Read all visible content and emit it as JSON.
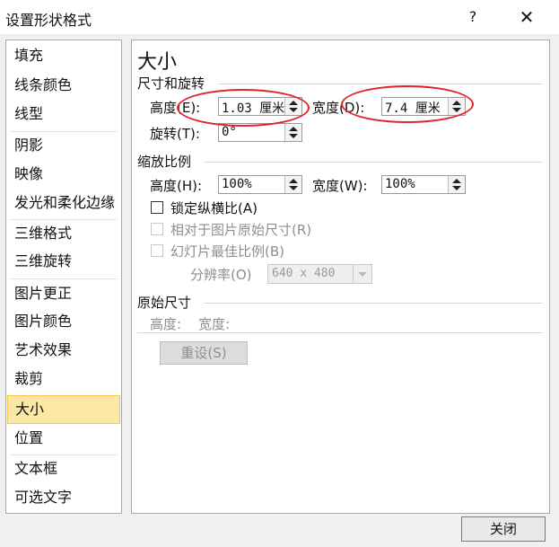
{
  "window": {
    "title": "设置形状格式",
    "help_label": "?",
    "close_label": "✕"
  },
  "sidebar": {
    "items": [
      {
        "label": "填充"
      },
      {
        "label": "线条颜色"
      },
      {
        "label": "线型"
      },
      {
        "label": "阴影"
      },
      {
        "label": "映像"
      },
      {
        "label": "发光和柔化边缘"
      },
      {
        "label": "三维格式"
      },
      {
        "label": "三维旋转"
      },
      {
        "label": "图片更正"
      },
      {
        "label": "图片颜色"
      },
      {
        "label": "艺术效果"
      },
      {
        "label": "裁剪"
      },
      {
        "label": "大小",
        "selected": true
      },
      {
        "label": "位置"
      },
      {
        "label": "文本框"
      },
      {
        "label": "可选文字"
      }
    ]
  },
  "panel": {
    "heading": "大小",
    "size_section": {
      "title": "尺寸和旋转",
      "height_label": "高度(E):",
      "height_value": "1.03 厘米",
      "width_label": "宽度(D):",
      "width_value": "7.4 厘米",
      "rotation_label": "旋转(T):",
      "rotation_value": "0°"
    },
    "scale_section": {
      "title": "缩放比例",
      "height_label": "高度(H):",
      "height_value": "100%",
      "width_label": "宽度(W):",
      "width_value": "100%",
      "lock_aspect_label": "锁定纵横比(A)",
      "relative_original_label": "相对于图片原始尺寸(R)",
      "best_scale_label": "幻灯片最佳比例(B)",
      "resolution_label": "分辨率(O)",
      "resolution_value": "640 x 480"
    },
    "original_section": {
      "title": "原始尺寸",
      "height_label": "高度:",
      "width_label": "宽度:",
      "reset_label": "重设(S)"
    }
  },
  "footer": {
    "close_label": "关闭"
  },
  "colors": {
    "selected_bg": "#fce8a6",
    "annotation_red": "#e0242a"
  }
}
